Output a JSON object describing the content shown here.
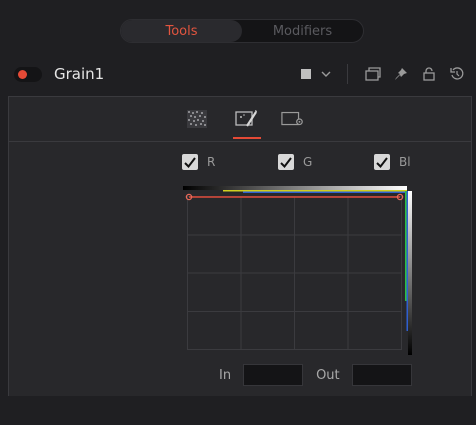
{
  "tabs": [
    {
      "label": "Tools",
      "active": true
    },
    {
      "label": "Modifiers",
      "active": false
    }
  ],
  "node": {
    "title": "Grain1",
    "enabled": true,
    "color_swatch": "#bfbfbf"
  },
  "subtabs": [
    {
      "icon": "grain-pattern-icon",
      "active": false
    },
    {
      "icon": "curves-magic-icon",
      "active": true
    },
    {
      "icon": "settings-icon",
      "active": false
    }
  ],
  "channels": [
    {
      "label": "R",
      "checked": true
    },
    {
      "label": "G",
      "checked": true
    },
    {
      "label": "Bl",
      "checked": true
    }
  ],
  "io": {
    "in_label": "In",
    "in_value": "",
    "out_label": "Out",
    "out_value": ""
  },
  "colors": {
    "accent": "#e54a36",
    "background": "#1f1f22",
    "panel": "#28282b"
  }
}
